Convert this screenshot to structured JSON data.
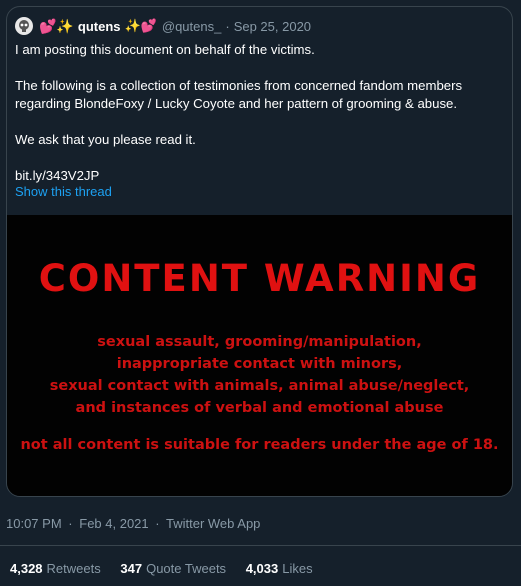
{
  "tweet": {
    "author": {
      "emoji_before": "💕✨",
      "display_name": "qutens",
      "emoji_after": "✨💕",
      "handle": "@qutens_"
    },
    "date": "Sep 25, 2020",
    "text_lines": [
      "I am posting this document on behalf of the victims.",
      "The following is a collection of testimonies from concerned fandom members",
      "regarding BlondeFoxy / Lucky Coyote and her pattern of grooming & abuse.",
      "We ask that you please read it.",
      "bit.ly/343V2JP"
    ],
    "show_thread": "Show this thread",
    "media": {
      "title": "CONTENT WARNING",
      "lines": [
        "sexual assault, grooming/manipulation,",
        "inappropriate contact with minors,",
        "sexual contact with animals, animal abuse/neglect,",
        "and instances of verbal and emotional abuse"
      ],
      "footer": "not all content is suitable for readers under the age of 18."
    },
    "timestamp": "10:07 PM",
    "timestamp_date": "Feb 4, 2021",
    "source": "Twitter Web App",
    "stats": {
      "retweets": {
        "count": "4,328",
        "label": "Retweets"
      },
      "quotes": {
        "count": "347",
        "label": "Quote Tweets"
      },
      "likes": {
        "count": "4,033",
        "label": "Likes"
      }
    }
  },
  "colors": {
    "background": "#15202b",
    "link": "#1da1f2",
    "muted": "#8899a6",
    "warning_red": "#e01111"
  }
}
